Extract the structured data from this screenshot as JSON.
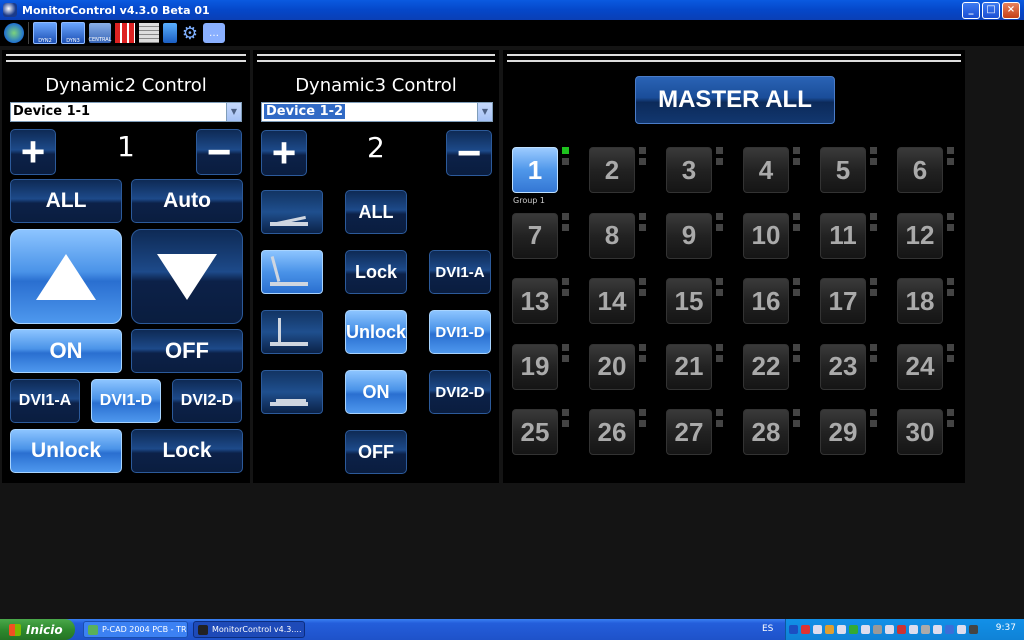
{
  "window": {
    "title": "MonitorControl v4.3.0 Beta 01",
    "min": "_",
    "max": "□",
    "close": "×"
  },
  "toolbar": {
    "mon1_label": "DYN2",
    "mon2_label": "DYN3",
    "mon3_label": "CENTRAL"
  },
  "panel1": {
    "title": "Dynamic2 Control",
    "device": "Device 1-1",
    "plus": "+",
    "minus": "−",
    "count": "1",
    "all": "ALL",
    "auto": "Auto",
    "on": "ON",
    "off": "OFF",
    "dvi1a": "DVI1-A",
    "dvi1d": "DVI1-D",
    "dvi2d": "DVI2-D",
    "unlock": "Unlock",
    "lock": "Lock"
  },
  "panel2": {
    "title": "Dynamic3 Control",
    "device": "Device 1-2",
    "plus": "+",
    "minus": "−",
    "count": "2",
    "all": "ALL",
    "lock": "Lock",
    "unlock": "Unlock",
    "on": "ON",
    "off": "OFF",
    "dvi1a": "DVI1-A",
    "dvi1d": "DVI1-D",
    "dvi2d": "DVI2-D"
  },
  "panel3": {
    "master": "MASTER ALL",
    "group_label": "Group 1",
    "cells": [
      "1",
      "2",
      "3",
      "4",
      "5",
      "6",
      "7",
      "8",
      "9",
      "10",
      "11",
      "12",
      "13",
      "14",
      "15",
      "16",
      "17",
      "18",
      "19",
      "20",
      "21",
      "22",
      "23",
      "24",
      "25",
      "26",
      "27",
      "28",
      "29",
      "30"
    ]
  },
  "taskbar": {
    "start": "Inicio",
    "task1": "P-CAD 2004 PCB - TR...",
    "task2": "MonitorControl v4.3....",
    "lang": "ES",
    "clock": "9:37"
  }
}
